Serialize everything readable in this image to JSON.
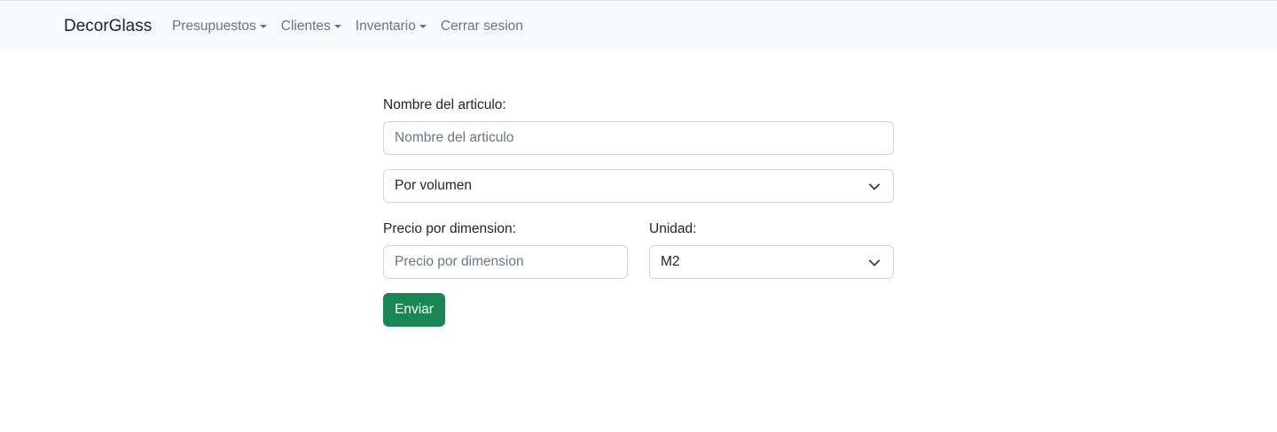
{
  "navbar": {
    "brand": "DecorGlass",
    "items": [
      {
        "label": "Presupuestos",
        "dropdown": true
      },
      {
        "label": "Clientes",
        "dropdown": true
      },
      {
        "label": "Inventario",
        "dropdown": true
      },
      {
        "label": "Cerrar sesion",
        "dropdown": false
      }
    ]
  },
  "form": {
    "nombre_label": "Nombre del articulo:",
    "nombre_placeholder": "Nombre del articulo",
    "tipo_selected": "Por volumen",
    "precio_label": "Precio por dimension:",
    "precio_placeholder": "Precio por dimension",
    "unidad_label": "Unidad:",
    "unidad_selected": "M2",
    "submit_label": "Enviar"
  },
  "colors": {
    "navbar_bg": "#f8f9fa",
    "button_bg": "#198754",
    "border": "#ced4da",
    "muted_text": "#6c757d"
  },
  "icons": {
    "select_chevron": "chevron-down-icon",
    "nav_caret": "caret-down-icon"
  }
}
